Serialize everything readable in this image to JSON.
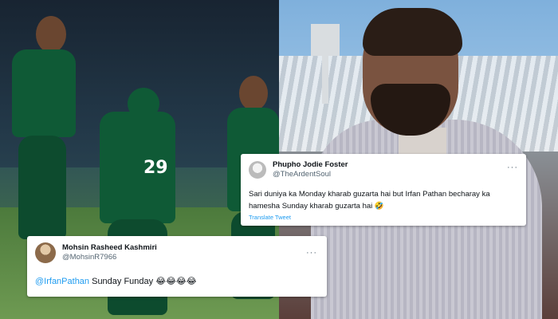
{
  "tweet_1": {
    "display_name": "Phupho Jodie Foster",
    "handle": "@TheArdentSoul",
    "text": "Sari duniya ka Monday kharab guzarta hai but Irfan Pathan becharay ka hamesha Sunday kharab guzarta hai 🤣",
    "translate_label": "Translate Tweet",
    "more_glyph": "···"
  },
  "tweet_2": {
    "display_name": "Mohsin Rasheed Kashmiri",
    "handle": "@MohsinR7966",
    "mention": "@IrfanPathan",
    "text": " Sunday Funday 😂😂😂😂",
    "more_glyph": "···"
  },
  "left_photo": {
    "jersey_number": "29"
  },
  "colors": {
    "link": "#1d9bf0",
    "secondary_text": "#536471"
  }
}
